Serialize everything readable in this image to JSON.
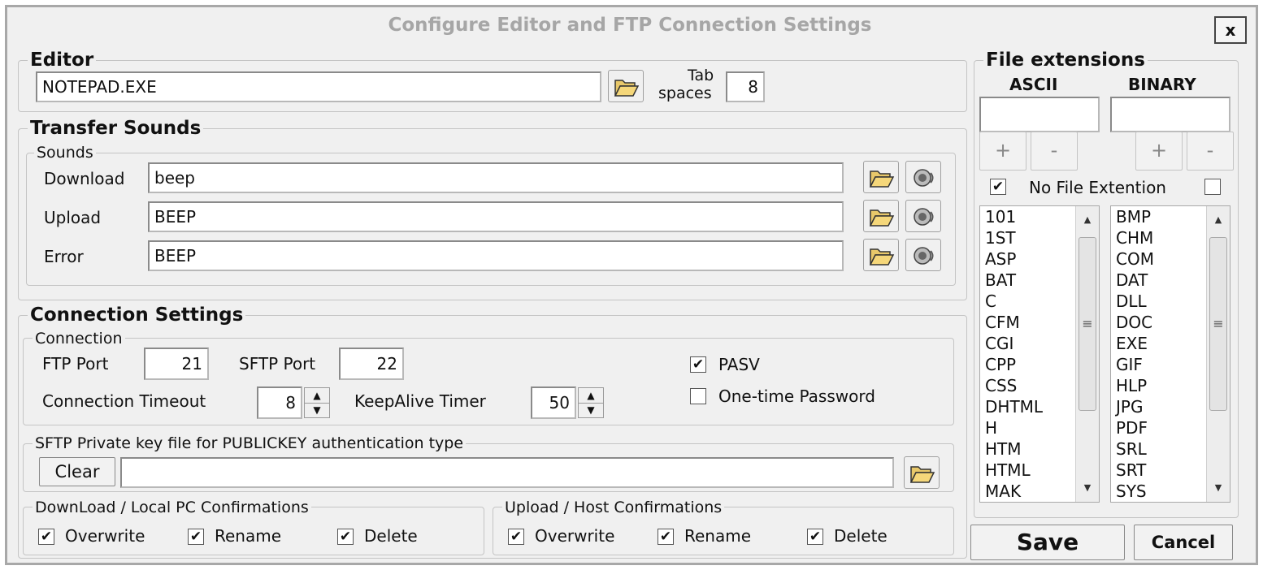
{
  "window": {
    "title": "Configure Editor and FTP Connection Settings",
    "close_label": "x"
  },
  "editor": {
    "legend": "Editor",
    "path": "NOTEPAD.EXE",
    "tab_label_1": "Tab",
    "tab_label_2": "spaces",
    "tab_value": "8"
  },
  "sounds": {
    "legend": "Transfer Sounds",
    "sub_legend": "Sounds",
    "rows": [
      {
        "label": "Download",
        "value": "beep"
      },
      {
        "label": "Upload",
        "value": "BEEP"
      },
      {
        "label": "Error",
        "value": "BEEP"
      }
    ]
  },
  "connection": {
    "legend": "Connection Settings",
    "sub_legend": "Connection",
    "ftp_port_label": "FTP Port",
    "ftp_port": "21",
    "sftp_port_label": "SFTP Port",
    "sftp_port": "22",
    "timeout_label": "Connection Timeout",
    "timeout": "8",
    "keepalive_label": "KeepAlive Timer",
    "keepalive": "50",
    "pasv_label": "PASV",
    "pasv_checked": true,
    "otp_label": "One-time Password",
    "otp_checked": false
  },
  "sftp_key": {
    "legend": "SFTP Private key file for PUBLICKEY authentication type",
    "clear_label": "Clear",
    "value": ""
  },
  "download_confirm": {
    "legend": "DownLoad / Local PC Confirmations",
    "overwrite": "Overwrite",
    "rename": "Rename",
    "delete": "Delete"
  },
  "upload_confirm": {
    "legend": "Upload / Host Confirmations",
    "overwrite": "Overwrite",
    "rename": "Rename",
    "delete": "Delete"
  },
  "extensions": {
    "legend": "File extensions",
    "ascii_label": "ASCII",
    "binary_label": "BINARY",
    "plus": "+",
    "minus": "-",
    "no_ext_label": "No File Extention",
    "ascii_items": [
      "101",
      "1ST",
      "ASP",
      "BAT",
      "C",
      "CFM",
      "CGI",
      "CPP",
      "CSS",
      "DHTML",
      "H",
      "HTM",
      "HTML",
      "MAK"
    ],
    "binary_items": [
      "BMP",
      "CHM",
      "COM",
      "DAT",
      "DLL",
      "DOC",
      "EXE",
      "GIF",
      "HLP",
      "JPG",
      "PDF",
      "SRL",
      "SRT",
      "SYS"
    ]
  },
  "buttons": {
    "save": "Save",
    "cancel": "Cancel"
  },
  "icons": {
    "folder": "folder-open-icon",
    "speaker": "speaker-icon",
    "check": "✔"
  }
}
